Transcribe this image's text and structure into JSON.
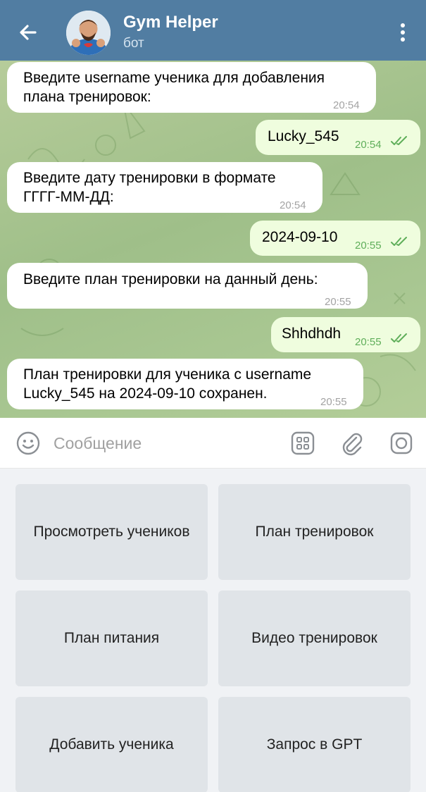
{
  "header": {
    "title": "Gym Helper",
    "subtitle": "бот",
    "back_icon": "arrow-left-icon",
    "menu_icon": "more-vertical-icon",
    "bg_color": "#517da2"
  },
  "messages": [
    {
      "direction": "in",
      "lines": [
        "Введите username ученика для добавления",
        "плана тренировок:"
      ],
      "time": "20:54"
    },
    {
      "direction": "out",
      "lines": [
        "Lucky_545"
      ],
      "time": "20:54",
      "read": true
    },
    {
      "direction": "in",
      "lines": [
        "Введите дату тренировки в формате",
        "ГГГГ-ММ-ДД:"
      ],
      "time": "20:54"
    },
    {
      "direction": "out",
      "lines": [
        "2024-09-10"
      ],
      "time": "20:55",
      "read": true
    },
    {
      "direction": "in",
      "lines": [
        "Введите план тренировки на данный день:"
      ],
      "time": "20:55"
    },
    {
      "direction": "out",
      "lines": [
        "Shhdhdh"
      ],
      "time": "20:55",
      "read": true
    },
    {
      "direction": "in",
      "lines": [
        "План тренировки для ученика с username",
        "Lucky_545 на 2024-09-10 сохранен."
      ],
      "time": "20:55"
    }
  ],
  "composer": {
    "placeholder": "Сообщение",
    "icons": [
      "emoji-icon",
      "keyboard-grid-icon",
      "attach-icon",
      "camera-icon"
    ]
  },
  "keyboard": {
    "buttons": [
      "Просмотреть учеников",
      "План тренировок",
      "План питания",
      "Видео тренировок",
      "Добавить ученика",
      "Запрос в GPT"
    ]
  }
}
